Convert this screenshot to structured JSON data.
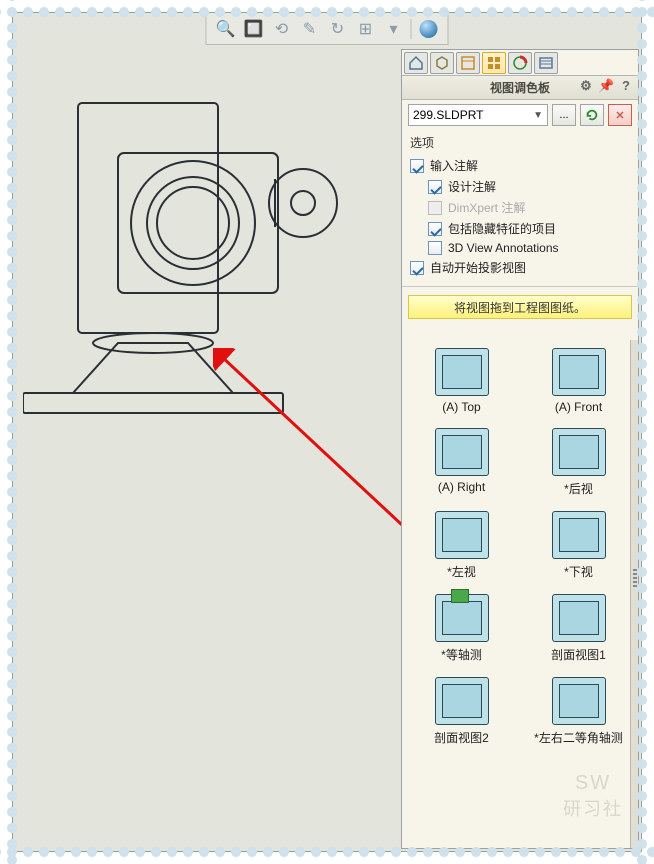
{
  "toolbar": {
    "icons": [
      "zoom-fit",
      "zoom-window",
      "prev-view",
      "rotate",
      "section",
      "undo-view",
      "view-settings",
      "separator",
      "render-sphere"
    ]
  },
  "pane": {
    "tabs": [
      "home",
      "assembly",
      "custom-props",
      "views",
      "appearance",
      "resources"
    ],
    "title": "视图调色板",
    "file_name": "299.SLDPRT",
    "browse_label": "...",
    "options_title": "选项",
    "opt_import_annotations": "输入注解",
    "opt_design_annotations": "设计注解",
    "opt_dimxpert": "DimXpert 注解",
    "opt_hidden_features": "包括隐藏特征的项目",
    "opt_3d_view": "3D View Annotations",
    "opt_auto_proj": "自动开始投影视图",
    "drag_banner": "将视图拖到工程图图纸。",
    "checks": {
      "import_annotations": true,
      "design_annotations": true,
      "dimxpert": false,
      "hidden_features": true,
      "3d_view": false,
      "auto_proj": true
    }
  },
  "views": [
    {
      "label": "(A) Top"
    },
    {
      "label": "(A) Front"
    },
    {
      "label": "(A) Right"
    },
    {
      "label": "*后视"
    },
    {
      "label": "*左视"
    },
    {
      "label": "*下视"
    },
    {
      "label": "*等轴测"
    },
    {
      "label": "剖面视图1"
    },
    {
      "label": "剖面视图2"
    },
    {
      "label": "*左右二等角轴测"
    }
  ]
}
